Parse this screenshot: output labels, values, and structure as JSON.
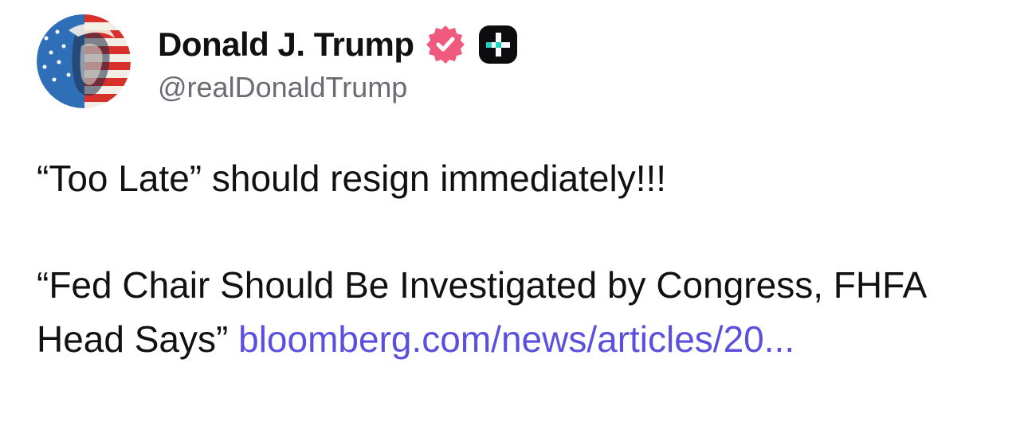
{
  "post": {
    "author": {
      "display_name": "Donald J. Trump",
      "handle": "@realDonaldTrump",
      "avatar_icon": "avatar-portrait-flag",
      "verified_badge_icon": "verified-badge-icon",
      "verified_color": "#f05a7e",
      "plus_badge_icon": "plus-badge-icon"
    },
    "paragraph_1": "“Too Late” should resign immediately!!!",
    "paragraph_2_text": "“Fed Chair Should Be Investigated by Congress, FHFA Head Says” ",
    "link_text": "bloomberg.com/news/articles/20...",
    "link_color": "#5b4fe0"
  }
}
